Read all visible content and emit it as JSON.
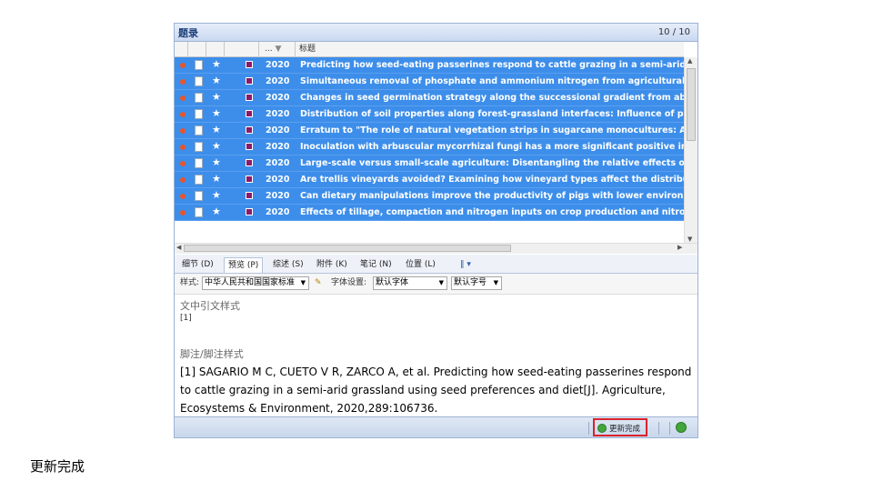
{
  "window": {
    "title": "题录",
    "count": "10 / 10"
  },
  "columns": {
    "sort_col": "...",
    "title_col": "标题"
  },
  "rows": [
    {
      "year": "2020",
      "title": "Predicting how seed-eating passerines respond to cattle grazing in a semi-arid grass"
    },
    {
      "year": "2020",
      "title": "Simultaneous removal of phosphate and ammonium nitrogen from agricultural runo"
    },
    {
      "year": "2020",
      "title": "Changes in seed germination strategy along the successional gradient from abandon"
    },
    {
      "year": "2020",
      "title": "Distribution of soil properties along forest-grassland interfaces: Influence of perman"
    },
    {
      "year": "2020",
      "title": "Erratum to \"The role of natural vegetation strips in sugarcane monocultures: Ant an"
    },
    {
      "year": "2020",
      "title": "Inoculation with arbuscular mycorrhizal fungi has a more significant positive impact"
    },
    {
      "year": "2020",
      "title": "Large-scale versus small-scale agriculture: Disentangling the relative effects of the fa"
    },
    {
      "year": "2020",
      "title": "Are trellis vineyards avoided? Examining how vineyard types affect the distribution o"
    },
    {
      "year": "2020",
      "title": "Can dietary manipulations improve the productivity of pigs with lower environmenta"
    },
    {
      "year": "2020",
      "title": "Effects of tillage, compaction and nitrogen inputs on crop production and nitrogen l"
    }
  ],
  "tabs": [
    "细节 (D)",
    "预览 (P)",
    "综述 (S)",
    "附件 (K)",
    "笔记 (N)",
    "位置 (L)"
  ],
  "toolbar": {
    "style_label": "样式:",
    "style_value": "中华人民共和国国家标准",
    "font_label": "字体设置:",
    "font_value": "默认字体",
    "size_value": "默认字号"
  },
  "preview": {
    "intext_heading": "文中引文样式",
    "intext_value": "[1]",
    "footnote_heading": "脚注/脚注样式",
    "reference": "[1]    SAGARIO M C, CUETO V R, ZARCO A, et al. Predicting how seed-eating passerines respond to cattle grazing in a semi-arid grassland using seed preferences and diet[J]. Agriculture, Ecosystems & Environment, 2020,289:106736."
  },
  "status": {
    "update_button": "更新完成"
  },
  "caption": "更新完成",
  "colors": {
    "row_selected": "#3d8eea",
    "highlight_box": "#d9232d"
  }
}
